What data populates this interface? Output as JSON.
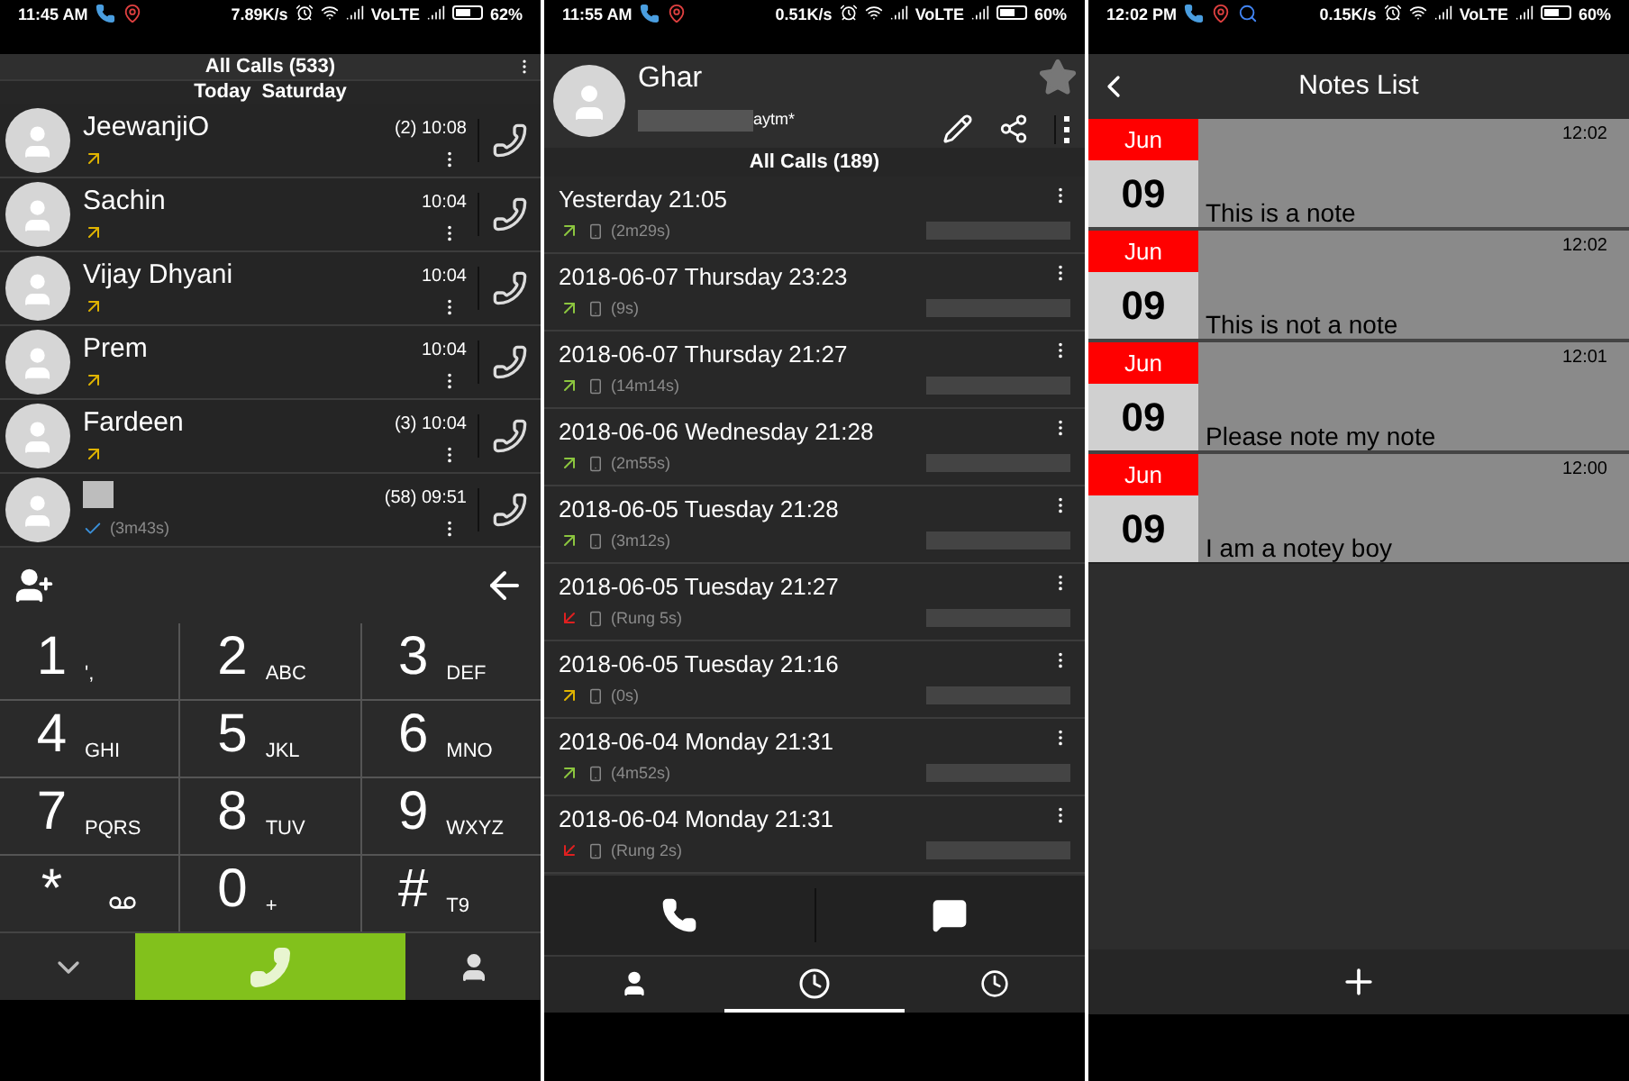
{
  "dialer": {
    "status_bar": {
      "time": "11:45 AM",
      "notifications": [
        {
          "kind": "phone"
        },
        {
          "kind": "map"
        }
      ],
      "speed": "7.89K/s",
      "network": "VoLTE",
      "battery": "62%"
    },
    "header": "All Calls (533)",
    "date_heading": "Today  Saturday",
    "calls": [
      {
        "name": "JeewanjiO",
        "redacted": false,
        "time": "(2) 10:08",
        "kind": "outgoing",
        "color": "#e0b400"
      },
      {
        "name": "Sachin",
        "redacted": false,
        "time": "10:04",
        "kind": "outgoing",
        "color": "#e0b400"
      },
      {
        "name": "Vijay Dhyani",
        "redacted": false,
        "time": "10:04",
        "kind": "outgoing",
        "color": "#e0b400"
      },
      {
        "name": "Prem",
        "redacted": false,
        "time": "10:04",
        "kind": "outgoing",
        "color": "#e0b400"
      },
      {
        "name": "Fardeen",
        "redacted": false,
        "time": "(3) 10:04",
        "kind": "outgoing",
        "color": "#e0b400"
      },
      {
        "redacted": true,
        "time": "(58) 09:51",
        "kind": "answered",
        "color": "#3a8fd8",
        "duration": "(3m43s)"
      }
    ],
    "keypad": [
      {
        "digit": "1",
        "kind": "text",
        "letters": "',"
      },
      {
        "digit": "2",
        "kind": "text",
        "letters": "ABC"
      },
      {
        "digit": "3",
        "kind": "text",
        "letters": "DEF"
      },
      {
        "digit": "4",
        "kind": "text",
        "letters": "GHI"
      },
      {
        "digit": "5",
        "kind": "text",
        "letters": "JKL"
      },
      {
        "digit": "6",
        "kind": "text",
        "letters": "MNO"
      },
      {
        "digit": "7",
        "kind": "text",
        "letters": "PQRS"
      },
      {
        "digit": "8",
        "kind": "text",
        "letters": "TUV"
      },
      {
        "digit": "9",
        "kind": "text",
        "letters": "WXYZ"
      },
      {
        "digit": "*",
        "kind": "voicemail"
      },
      {
        "digit": "0",
        "kind": "text",
        "letters": "+"
      },
      {
        "digit": "#",
        "kind": "text",
        "letters": "T9"
      }
    ]
  },
  "contact": {
    "status_bar": {
      "time": "11:55 AM",
      "notifications": [
        {
          "kind": "phone"
        },
        {
          "kind": "map"
        }
      ],
      "speed": "0.51K/s",
      "network": "VoLTE",
      "battery": "60%"
    },
    "name": "Ghar",
    "subtitle": "aytm*",
    "header": "All Calls (189)",
    "calls": [
      {
        "title": "Yesterday 21:05",
        "kind": "outgoing",
        "color": "#8cc63f",
        "duration": "(2m29s)"
      },
      {
        "title": "2018-06-07 Thursday 23:23",
        "kind": "outgoing",
        "color": "#8cc63f",
        "duration": "(9s)"
      },
      {
        "title": "2018-06-07 Thursday 21:27",
        "kind": "outgoing",
        "color": "#8cc63f",
        "duration": "(14m14s)"
      },
      {
        "title": "2018-06-06 Wednesday 21:28",
        "kind": "outgoing",
        "color": "#8cc63f",
        "duration": "(2m55s)"
      },
      {
        "title": "2018-06-05 Tuesday 21:28",
        "kind": "outgoing",
        "color": "#8cc63f",
        "duration": "(3m12s)"
      },
      {
        "title": "2018-06-05 Tuesday 21:27",
        "kind": "missed",
        "color": "#e02020",
        "duration": "(Rung 5s)"
      },
      {
        "title": "2018-06-05 Tuesday 21:16",
        "kind": "outgoing",
        "color": "#e0b400",
        "duration": "(0s)"
      },
      {
        "title": "2018-06-04 Monday 21:31",
        "kind": "outgoing",
        "color": "#8cc63f",
        "duration": "(4m52s)"
      },
      {
        "title": "2018-06-04 Monday 21:31",
        "kind": "missed",
        "color": "#e02020",
        "duration": "(Rung 2s)"
      }
    ],
    "tabs": [
      {
        "kind": "contacts",
        "selected": false
      },
      {
        "kind": "recents",
        "selected": true
      },
      {
        "kind": "history",
        "selected": false
      }
    ]
  },
  "notes": {
    "status_bar": {
      "time": "12:02 PM",
      "notifications": [
        {
          "kind": "phone"
        },
        {
          "kind": "map"
        },
        {
          "kind": "search"
        }
      ],
      "speed": "0.15K/s",
      "network": "VoLTE",
      "battery": "60%"
    },
    "title": "Notes List",
    "items": [
      {
        "month": "Jun",
        "day": "09",
        "time": "12:02",
        "text": "This is a note"
      },
      {
        "month": "Jun",
        "day": "09",
        "time": "12:02",
        "text": "This is not a note"
      },
      {
        "month": "Jun",
        "day": "09",
        "time": "12:01",
        "text": "Please note my note"
      },
      {
        "month": "Jun",
        "day": "09",
        "time": "12:00",
        "text": "I am a notey boy"
      }
    ]
  }
}
